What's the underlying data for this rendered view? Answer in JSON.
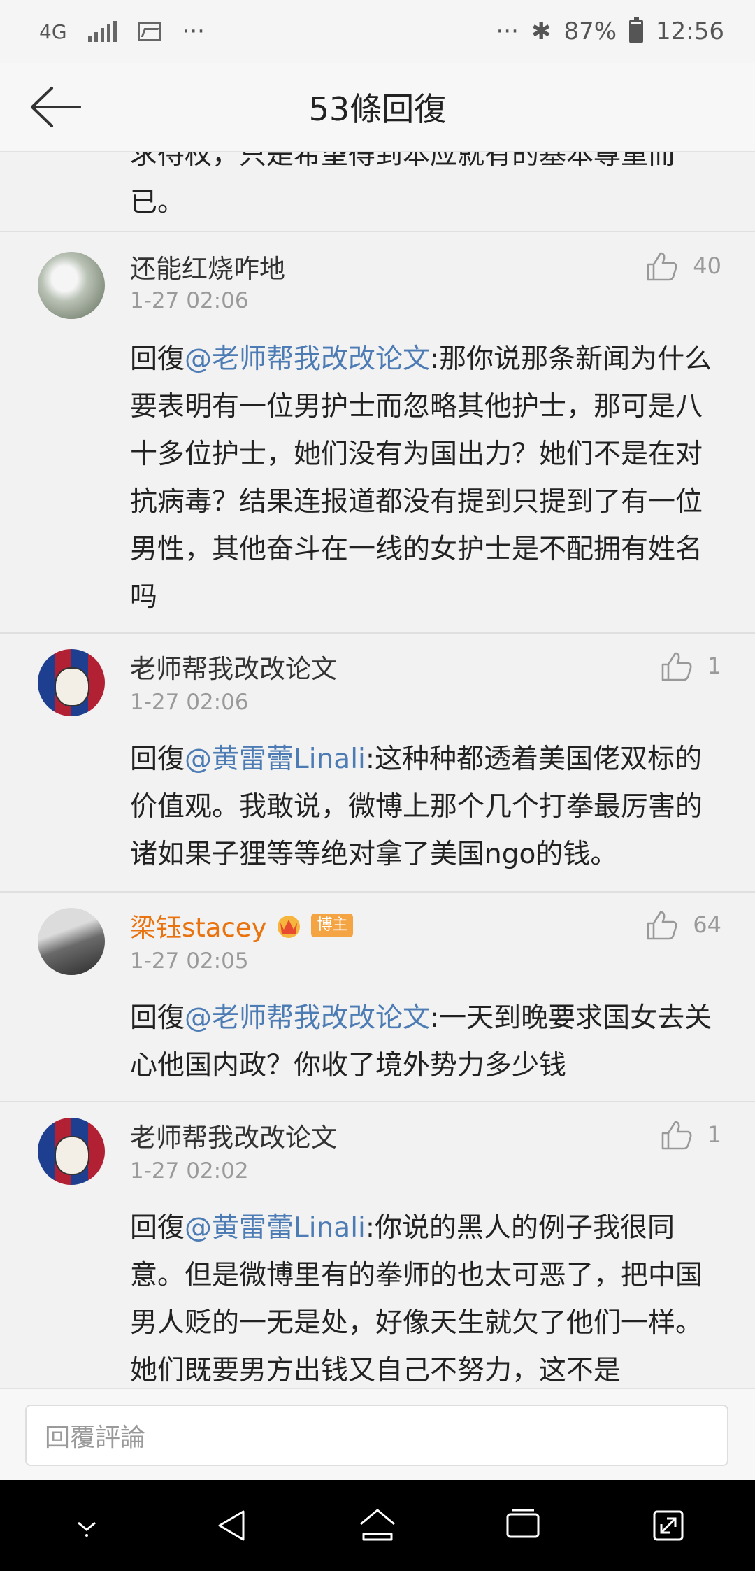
{
  "status_bar": {
    "network": "4G",
    "more": "···",
    "more_right": "···",
    "battery": "87%",
    "time": "12:56"
  },
  "header": {
    "title": "53條回復"
  },
  "partial_comment": {
    "text": "求待权，只是希望得到本应就有的基本尊重而已。"
  },
  "comments": [
    {
      "user": "还能红烧咋地",
      "time": "1-27 02:06",
      "likes": "40",
      "reply_prefix": "回復",
      "mention": "@老师帮我改改论文",
      "text": ":那你说那条新闻为什么要表明有一位男护士而忽略其他护士，那可是八十多位护士，她们没有为国出力？她们不是在对抗病毒？结果连报道都没有提到只提到了有一位男性，其他奋斗在一线的女护士是不配拥有姓名吗"
    },
    {
      "user": "老师帮我改改论文",
      "time": "1-27 02:06",
      "likes": "1",
      "reply_prefix": "回復",
      "mention": "@黄雷蕾Linali",
      "text": ":这种种都透着美国佬双标的价值观。我敢说，微博上那个几个打拳最厉害的诸如果子狸等等绝对拿了美国ngo的钱。"
    },
    {
      "user": "梁钰stacey",
      "badge": "博主",
      "time": "1-27 02:05",
      "likes": "64",
      "reply_prefix": "回復",
      "mention": "@老师帮我改改论文",
      "text": ":一天到晚要求国女去关心他国内政？你收了境外势力多少钱"
    },
    {
      "user": "老师帮我改改论文",
      "time": "1-27 02:02",
      "likes": "1",
      "reply_prefix": "回復",
      "mention": "@黄雷蕾Linali",
      "text": ":你说的黑人的例子我很同意。但是微博里有的拳师的也太可恶了，把中国男人贬的一无是处，好像天生就欠了他们一样。她们既要男方出钱又自己不努力，这不是"
    }
  ],
  "composer": {
    "placeholder": "回覆評論"
  },
  "colors": {
    "mention": "#4d7cb5",
    "vip_name": "#e8730f",
    "badge": "#f4a443"
  },
  "icons": [
    "back-arrow-icon",
    "thumbs-up-icon",
    "crown-icon",
    "nav-down-icon",
    "nav-back-icon",
    "nav-home-icon",
    "nav-recents-icon",
    "nav-fullscreen-icon"
  ]
}
